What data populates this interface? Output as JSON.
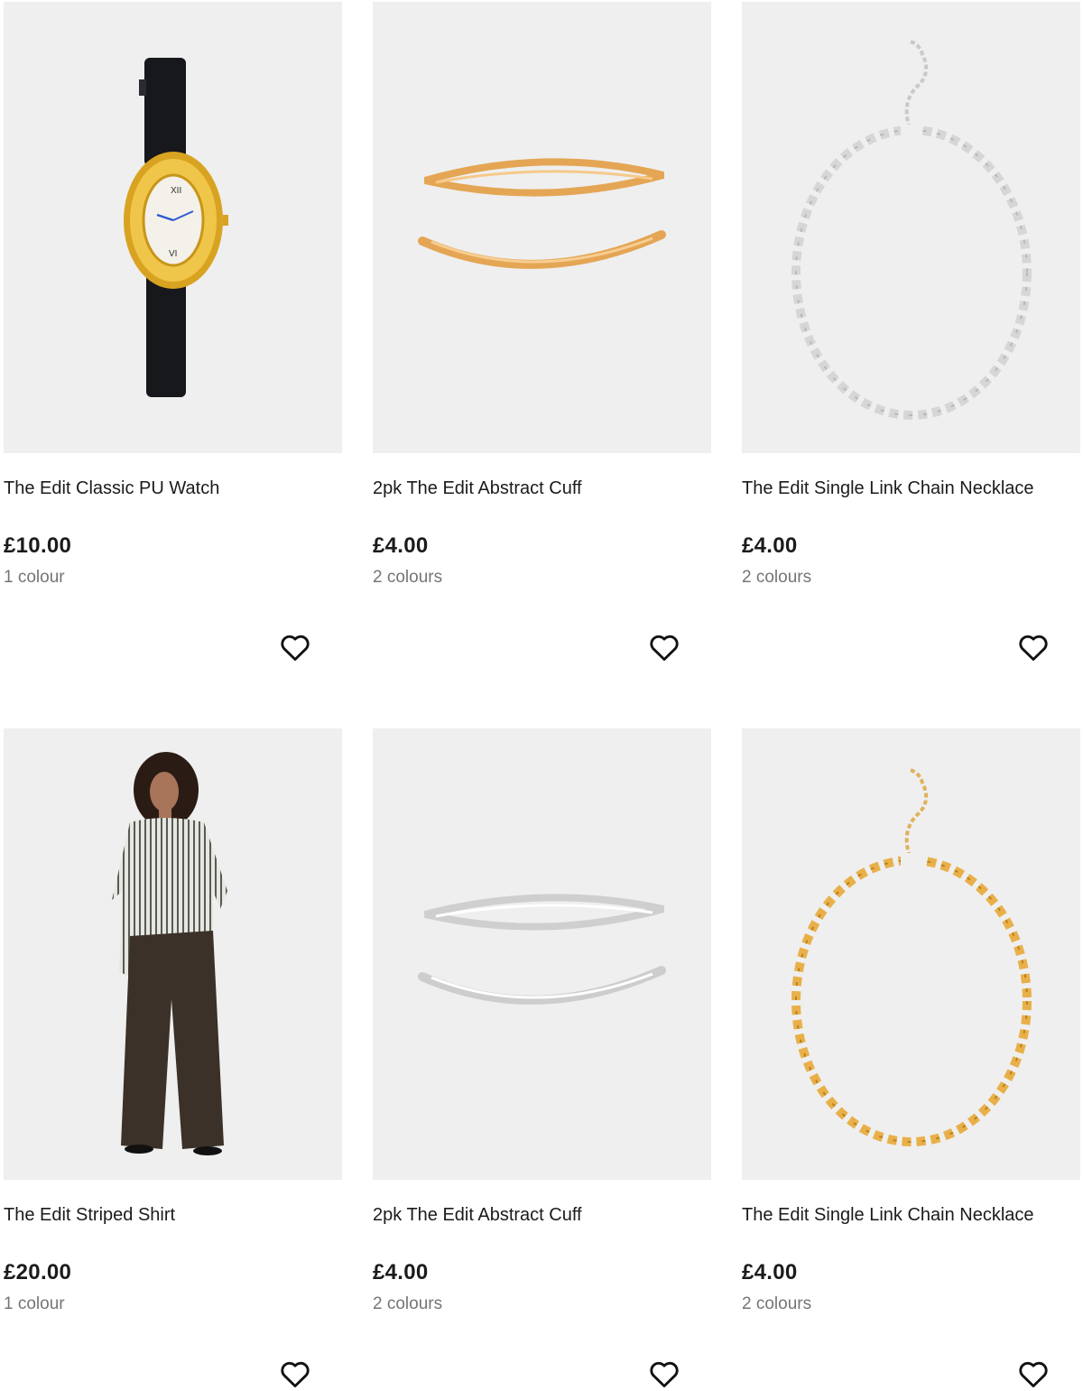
{
  "products": [
    {
      "title": "The Edit Classic PU Watch",
      "price": "£10.00",
      "colours": "1 colour",
      "image_icon": "watch-image",
      "wishlist_icon": "heart-icon"
    },
    {
      "title": "2pk The Edit Abstract Cuff",
      "price": "£4.00",
      "colours": "2 colours",
      "image_icon": "gold-cuff-image",
      "wishlist_icon": "heart-icon"
    },
    {
      "title": "The Edit Single Link Chain Necklace",
      "price": "£4.00",
      "colours": "2 colours",
      "image_icon": "silver-necklace-image",
      "wishlist_icon": "heart-icon"
    },
    {
      "title": "The Edit Striped Shirt",
      "price": "£20.00",
      "colours": "1 colour",
      "image_icon": "model-shirt-image",
      "wishlist_icon": "heart-icon"
    },
    {
      "title": "2pk The Edit Abstract Cuff",
      "price": "£4.00",
      "colours": "2 colours",
      "image_icon": "silver-cuff-image",
      "wishlist_icon": "heart-icon"
    },
    {
      "title": "The Edit Single Link Chain Necklace",
      "price": "£4.00",
      "colours": "2 colours",
      "image_icon": "gold-necklace-image",
      "wishlist_icon": "heart-icon"
    }
  ],
  "colors": {
    "image_bg": "#efefef",
    "text": "#1b1b1b",
    "muted": "#757575",
    "gold": "#e9b04a",
    "silver": "#d2d2d2"
  }
}
